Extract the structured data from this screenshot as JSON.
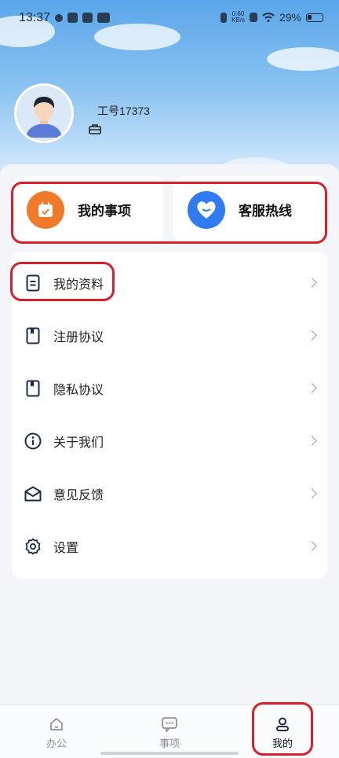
{
  "status_bar": {
    "time": "13:37",
    "net_speed_value": "0.60",
    "net_speed_unit": "KB/s",
    "battery": "29%",
    "icons": [
      "notification-icon",
      "app-icon",
      "tiktok-icon",
      "app-icon",
      "vibrate-icon",
      "sim-icon",
      "wifi-icon",
      "battery-icon"
    ]
  },
  "profile": {
    "employee_id": "工号17373",
    "avatar_icon": "user-avatar",
    "briefcase_icon": "briefcase-icon"
  },
  "quick_actions": [
    {
      "label": "我的事项",
      "icon": "calendar-check-icon",
      "color": "#f07a2a"
    },
    {
      "label": "客服热线",
      "icon": "heart-icon",
      "color": "#2f7cf2"
    }
  ],
  "menu": [
    {
      "label": "我的资料",
      "icon": "document-icon"
    },
    {
      "label": "注册协议",
      "icon": "book-icon"
    },
    {
      "label": "隐私协议",
      "icon": "book-icon"
    },
    {
      "label": "关于我们",
      "icon": "info-icon"
    },
    {
      "label": "意见反馈",
      "icon": "mail-icon"
    },
    {
      "label": "设置",
      "icon": "gear-icon"
    }
  ],
  "tabbar": [
    {
      "label": "办公",
      "icon": "home-icon",
      "active": false
    },
    {
      "label": "事项",
      "icon": "chat-icon",
      "active": false
    },
    {
      "label": "我的",
      "icon": "person-icon",
      "active": true
    }
  ],
  "colors": {
    "highlight": "#d8202c",
    "hero_top": "#5aa6ea",
    "accent_orange": "#f07a2a",
    "accent_blue": "#2f7cf2"
  }
}
